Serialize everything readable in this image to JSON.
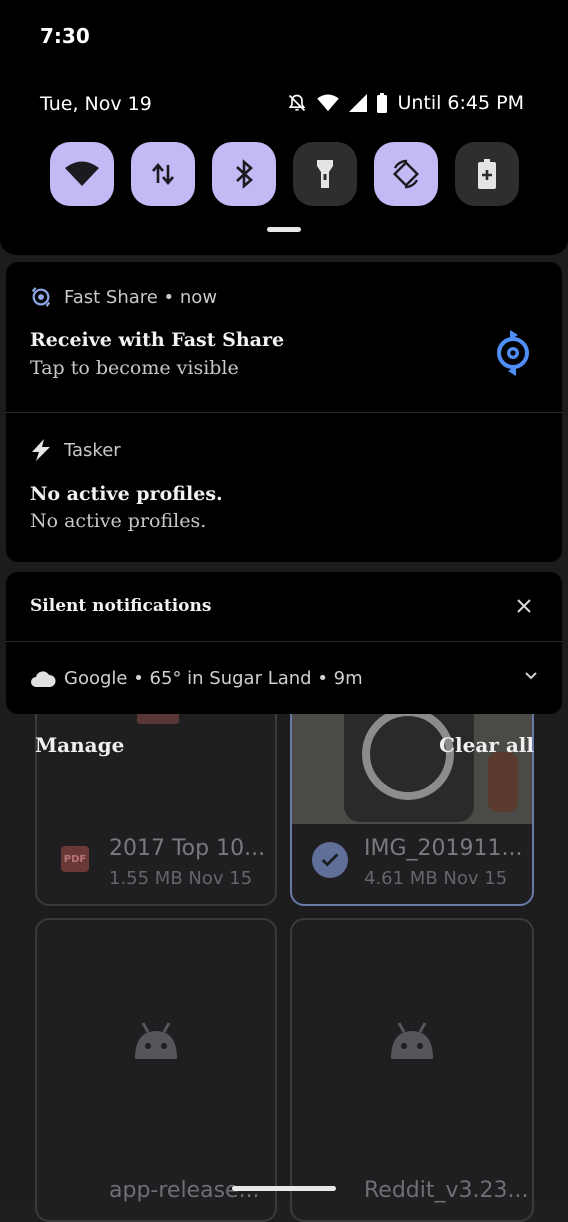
{
  "status_bar": {
    "time": "7:30",
    "date": "Tue, Nov 19",
    "alarm": "Until 6:45 PM"
  },
  "quick_settings": [
    {
      "name": "wifi",
      "icon": "wifi-icon",
      "on": true
    },
    {
      "name": "mobile-data",
      "icon": "data-arrows-icon",
      "on": true
    },
    {
      "name": "bluetooth",
      "icon": "bluetooth-icon",
      "on": true
    },
    {
      "name": "flashlight",
      "icon": "flashlight-icon",
      "on": false
    },
    {
      "name": "auto-rotate",
      "icon": "rotate-icon",
      "on": true
    },
    {
      "name": "battery-saver",
      "icon": "battery-saver-icon",
      "on": false
    }
  ],
  "notifications": {
    "fast_share": {
      "app": "Fast Share • now",
      "title": "Receive with Fast Share",
      "text": "Tap to become visible"
    },
    "tasker": {
      "app": "Tasker",
      "title": "No active profiles.",
      "text": "No active profiles."
    },
    "silent": {
      "header": "Silent notifications",
      "weather": "Google • 65° in Sugar Land • 9m"
    }
  },
  "background": {
    "manage": "Manage",
    "clear_all": "Clear all",
    "files": [
      {
        "title": "2017 Top 10...",
        "meta": "1.55 MB Nov 15",
        "type": "pdf"
      },
      {
        "title": "IMG_201911...",
        "meta": "4.61 MB Nov 15",
        "type": "image",
        "selected": true
      },
      {
        "title": "app-release...",
        "type": "apk"
      },
      {
        "title": "Reddit_v3.23...",
        "type": "apk"
      }
    ],
    "pdf_label": "PDF"
  },
  "colors": {
    "tile_on": "#c4b9f5",
    "tile_off": "#2e2e30",
    "fast_share_blue": "#4f8ef7"
  }
}
